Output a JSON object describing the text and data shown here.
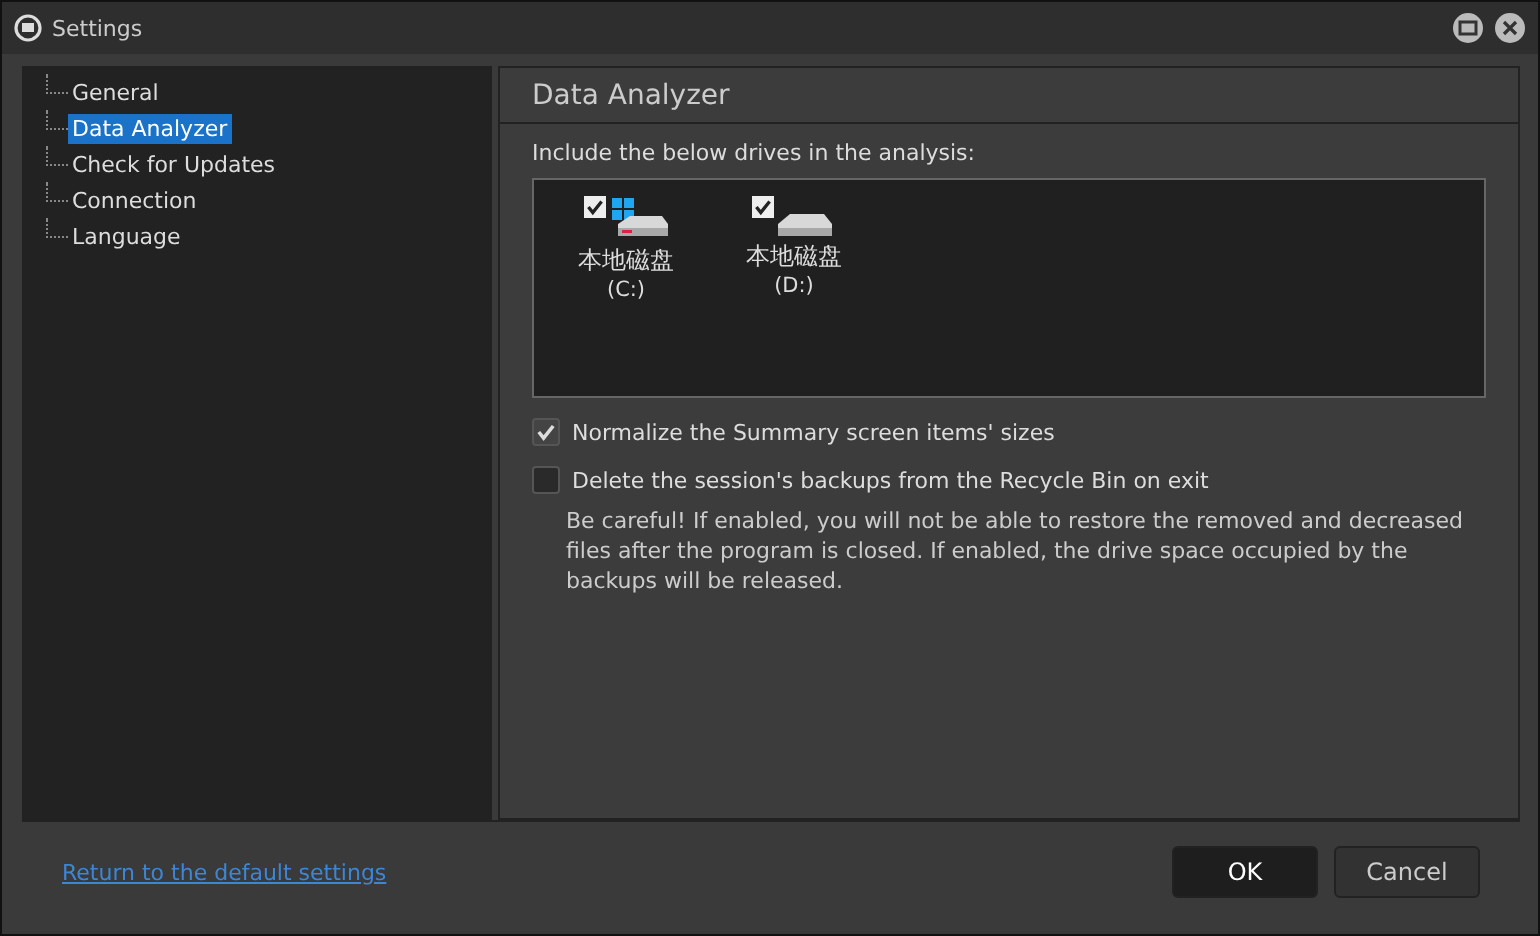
{
  "window": {
    "title": "Settings"
  },
  "sidebar": {
    "items": [
      {
        "label": "General",
        "selected": false
      },
      {
        "label": "Data Analyzer",
        "selected": true
      },
      {
        "label": "Check for Updates",
        "selected": false
      },
      {
        "label": "Connection",
        "selected": false
      },
      {
        "label": "Language",
        "selected": false
      }
    ]
  },
  "panel": {
    "title": "Data Analyzer",
    "drives_label": "Include the below drives in the analysis:",
    "drives": [
      {
        "kind": "system",
        "name": "本地磁盘",
        "letter": "(C:)",
        "checked": true
      },
      {
        "kind": "data",
        "name": "本地磁盘",
        "letter": "(D:)",
        "checked": true
      }
    ],
    "options": [
      {
        "label": "Normalize the Summary screen items' sizes",
        "checked": true
      },
      {
        "label": "Delete the session's backups from the Recycle Bin on exit",
        "checked": false,
        "note": "Be careful! If enabled, you will not be able to restore the removed and decreased files after the program is closed. If enabled, the drive space occupied by the backups will be released."
      }
    ]
  },
  "footer": {
    "link": "Return to the default settings",
    "buttons": [
      {
        "label": "OK",
        "kind": "primary"
      },
      {
        "label": "Cancel",
        "kind": "secondary"
      }
    ]
  }
}
